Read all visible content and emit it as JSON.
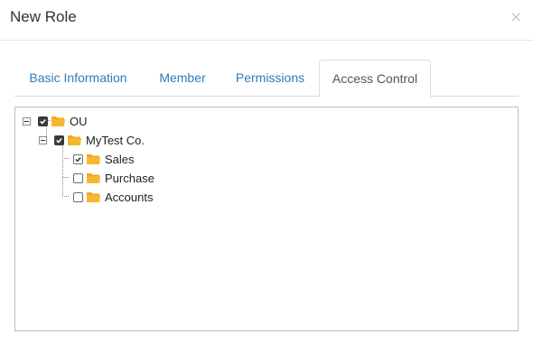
{
  "dialog": {
    "title": "New Role",
    "close_glyph": "×"
  },
  "tabs": [
    {
      "label": "Basic Information",
      "active": false
    },
    {
      "label": "Member",
      "active": false
    },
    {
      "label": "Permissions",
      "active": false
    },
    {
      "label": "Access Control",
      "active": true
    }
  ],
  "tree": {
    "root": {
      "label": "OU",
      "checked": true,
      "expanded": true
    },
    "company": {
      "label": "MyTest Co.",
      "checked": true,
      "expanded": true
    },
    "children": [
      {
        "label": "Sales",
        "checked": true
      },
      {
        "label": "Purchase",
        "checked": false
      },
      {
        "label": "Accounts",
        "checked": false
      }
    ]
  },
  "colors": {
    "link": "#337ab7",
    "folder": "#f7b731",
    "border": "#dddddd"
  }
}
